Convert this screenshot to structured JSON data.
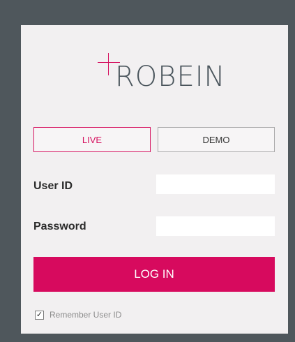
{
  "brand": {
    "logo_text": "ROBEIN",
    "accent_color": "#d70a5e"
  },
  "mode_tabs": {
    "live_label": "LIVE",
    "demo_label": "DEMO",
    "selected": "LIVE"
  },
  "form": {
    "user_id_label": "User ID",
    "user_id_value": "",
    "password_label": "Password",
    "password_value": ""
  },
  "login_button_label": "LOG IN",
  "remember": {
    "label": "Remember User ID",
    "checked": true,
    "check_glyph": "✓"
  }
}
